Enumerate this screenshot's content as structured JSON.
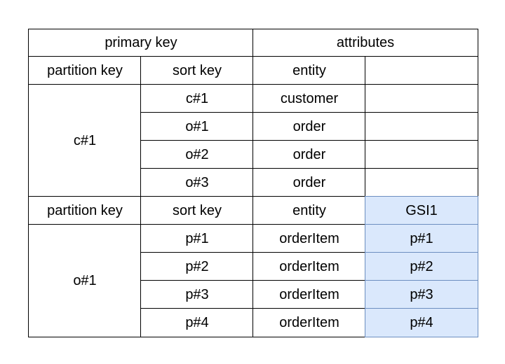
{
  "table": {
    "header": {
      "primary_key": "primary key",
      "attributes": "attributes"
    },
    "group1": {
      "col_headers": [
        "partition key",
        "sort key",
        "entity",
        ""
      ],
      "partition_value": "c#1",
      "rows": [
        {
          "sort_key": "c#1",
          "entity": "customer",
          "extra": ""
        },
        {
          "sort_key": "o#1",
          "entity": "order",
          "extra": ""
        },
        {
          "sort_key": "o#2",
          "entity": "order",
          "extra": ""
        },
        {
          "sort_key": "o#3",
          "entity": "order",
          "extra": ""
        }
      ]
    },
    "group2": {
      "col_headers": [
        "partition key",
        "sort key",
        "entity",
        "GSI1"
      ],
      "partition_value": "o#1",
      "rows": [
        {
          "sort_key": "p#1",
          "entity": "orderItem",
          "extra": "p#1"
        },
        {
          "sort_key": "p#2",
          "entity": "orderItem",
          "extra": "p#2"
        },
        {
          "sort_key": "p#3",
          "entity": "orderItem",
          "extra": "p#3"
        },
        {
          "sort_key": "p#4",
          "entity": "orderItem",
          "extra": "p#4"
        }
      ]
    },
    "colors": {
      "gsi_fill": "#dae8fc",
      "gsi_border": "#6c8ebf"
    }
  }
}
